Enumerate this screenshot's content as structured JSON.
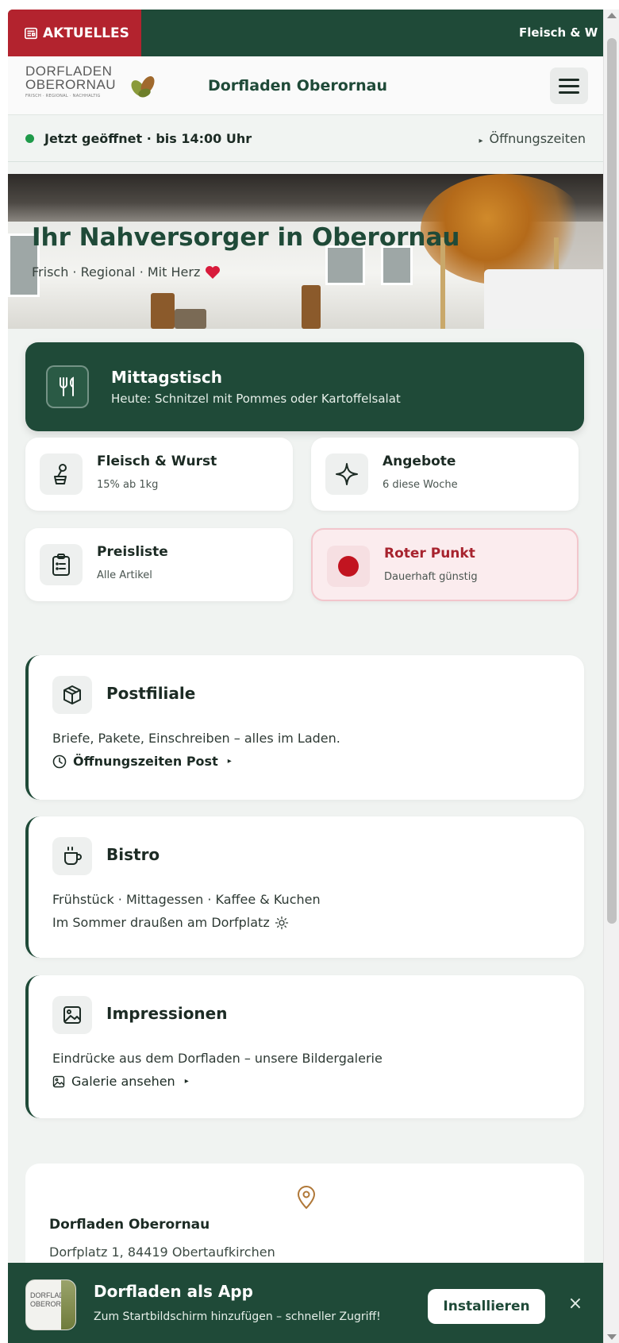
{
  "ticker": {
    "badge_label": "AKTUELLES",
    "scroll_text": "Fleisch & W"
  },
  "header": {
    "logo_line1": "DORFLADEN",
    "logo_line2": "OBERORNAU",
    "logo_tagline": "FRISCH · REGIONAL · NACHHALTIG",
    "title": "Dorfladen Oberornau",
    "menu_icon": "hamburger-icon"
  },
  "status": {
    "text": "Jetzt geöffnet · bis 14:00 Uhr",
    "hours_link": "Öffnungszeiten",
    "dot_color": "#1f9a4a"
  },
  "hero": {
    "title": "Ihr Nahversorger in Oberornau",
    "subtitle": "Frisch · Regional · Mit Herz"
  },
  "lunch": {
    "title": "Mittagstisch",
    "subtitle": "Heute: Schnitzel mit Pommes oder Kartoffelsalat",
    "icon": "cutlery-icon"
  },
  "tiles": [
    {
      "title": "Fleisch & Wurst",
      "subtitle": "15% ab 1kg",
      "icon": "meat-icon"
    },
    {
      "title": "Angebote",
      "subtitle": "6 diese Woche",
      "icon": "sparkle-icon"
    },
    {
      "title": "Preisliste",
      "subtitle": "Alle Artikel",
      "icon": "clipboard-icon"
    },
    {
      "title": "Roter Punkt",
      "subtitle": "Dauerhaft günstig",
      "icon": "red-dot-icon"
    }
  ],
  "cards": {
    "post": {
      "title": "Postfiliale",
      "text": "Briefe, Pakete, Einschreiben – alles im Laden.",
      "link": "Öffnungszeiten Post",
      "icon": "package-icon"
    },
    "bistro": {
      "title": "Bistro",
      "text": "Frühstück · Mittagessen · Kaffee & Kuchen",
      "text2": "Im Sommer draußen am Dorfplatz",
      "icon": "coffee-cup-icon"
    },
    "impressions": {
      "title": "Impressionen",
      "text": "Eindrücke aus dem Dorfladen – unsere Bildergalerie",
      "link": "Galerie ansehen",
      "icon": "image-icon"
    }
  },
  "address": {
    "name": "Dorfladen Oberornau",
    "street": "Dorfplatz 1, 84419 Obertaufkirchen"
  },
  "install_banner": {
    "title": "Dorfladen als App",
    "subtitle": "Zum Startbildschirm hinzufügen – schneller Zugriff!",
    "button": "Installieren",
    "close": "×",
    "logo_text": "DORFLADEN OBERORNAU"
  },
  "colors": {
    "brand_green": "#1f4a38",
    "accent_red": "#b3232e",
    "background": "#f0f3f1"
  }
}
